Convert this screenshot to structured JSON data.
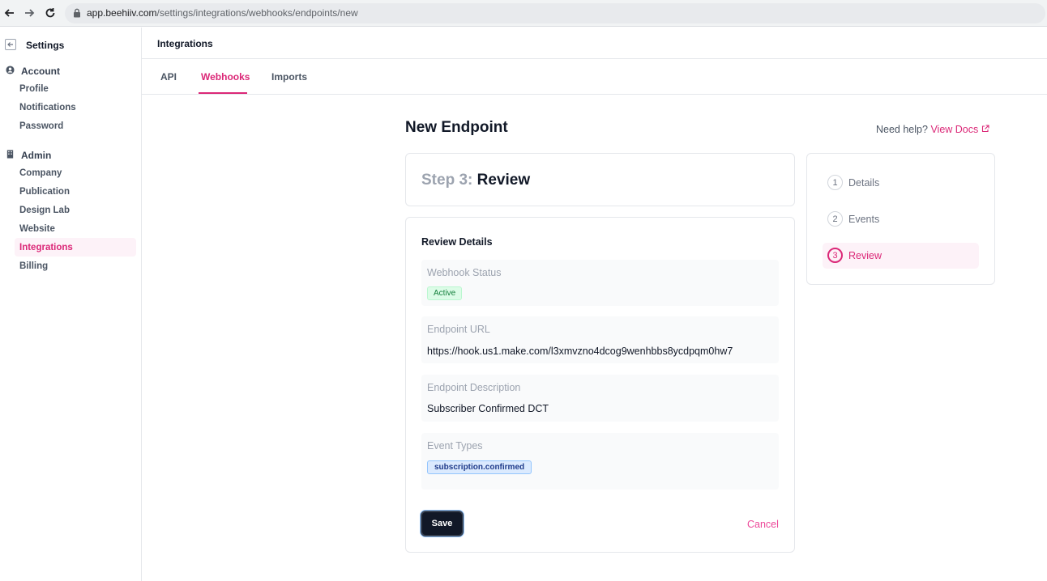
{
  "browser": {
    "url_domain": "app.beehiiv.com",
    "url_path": "/settings/integrations/webhooks/endpoints/new"
  },
  "sidebar": {
    "title": "Settings",
    "sections": [
      {
        "label": "Account",
        "icon": "user-circle-icon",
        "items": [
          "Profile",
          "Notifications",
          "Password"
        ]
      },
      {
        "label": "Admin",
        "icon": "building-icon",
        "items": [
          "Company",
          "Publication",
          "Design Lab",
          "Website",
          "Integrations",
          "Billing"
        ]
      }
    ],
    "active_item": "Integrations"
  },
  "header": {
    "title": "Integrations",
    "tabs": [
      "API",
      "Webhooks",
      "Imports"
    ],
    "active_tab": "Webhooks"
  },
  "page": {
    "title": "New Endpoint",
    "help_text": "Need help?",
    "help_link": "View Docs"
  },
  "step": {
    "number": "Step 3:",
    "name": "Review"
  },
  "review": {
    "title": "Review Details",
    "fields": [
      {
        "label": "Webhook Status",
        "badge": "Active"
      },
      {
        "label": "Endpoint URL",
        "value": "https://hook.us1.make.com/l3xmvzno4dcog9wenhbbs8ycdpqm0hw7"
      },
      {
        "label": "Endpoint Description",
        "value": "Subscriber Confirmed DCT"
      },
      {
        "label": "Event Types",
        "badge": "subscription.confirmed"
      }
    ],
    "save_label": "Save",
    "cancel_label": "Cancel"
  },
  "stepper": {
    "steps": [
      {
        "num": "1",
        "label": "Details"
      },
      {
        "num": "2",
        "label": "Events"
      },
      {
        "num": "3",
        "label": "Review"
      }
    ],
    "active_step": "Review"
  },
  "colors": {
    "accent": "#db2777",
    "dark_button": "#111827",
    "active_badge": "#dcfce7",
    "event_badge": "#dbeafe"
  }
}
